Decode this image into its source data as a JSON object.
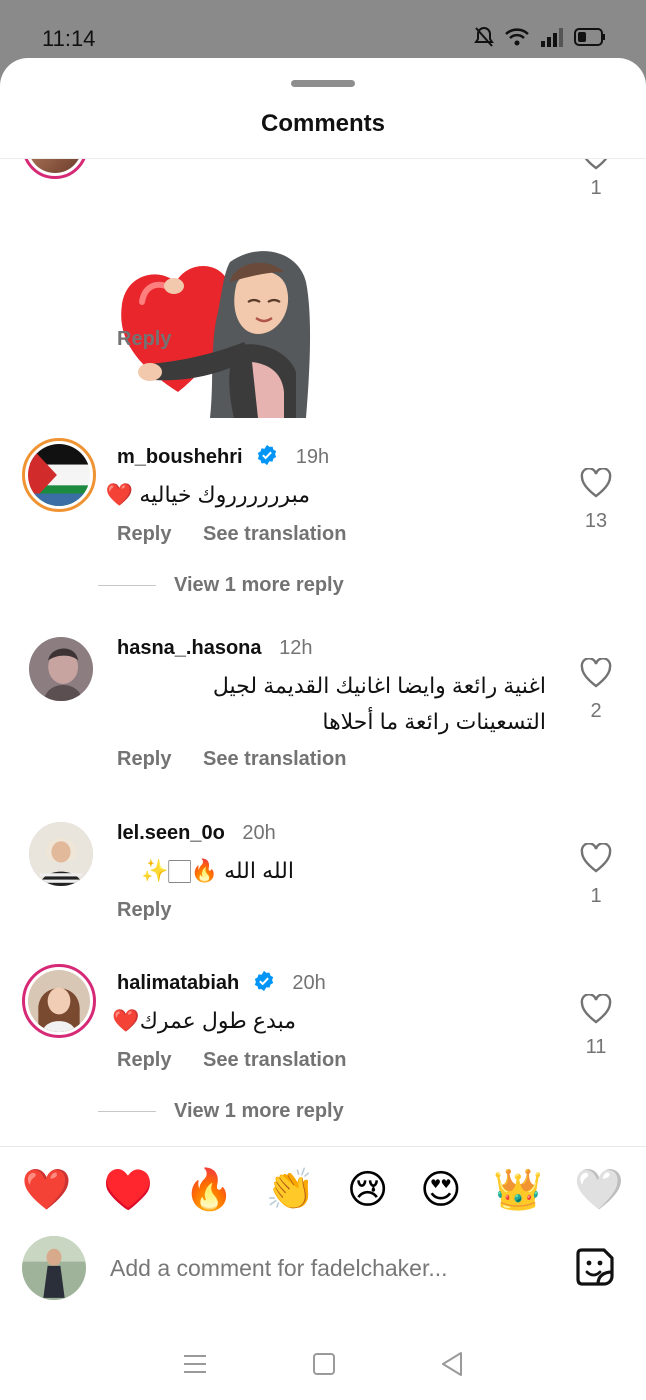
{
  "status": {
    "time": "11:14"
  },
  "sheet": {
    "title": "Comments"
  },
  "top_comment": {
    "likes": "1",
    "reply_label": "Reply"
  },
  "comments": [
    {
      "username": "m_boushehri",
      "verified": true,
      "time": "19h",
      "text": "مبرررررروك خياليه ❤️",
      "reply_label": "Reply",
      "translate_label": "See translation",
      "likes": "13",
      "more_replies": "View 1 more reply"
    },
    {
      "username": "hasna_.hasona",
      "verified": false,
      "time": "12h",
      "text_line1": "اغنية رائعة وايضا اغانيك القديمة لجيل",
      "text_line2": "التسعينات رائعة ما أحلاها",
      "reply_label": "Reply",
      "translate_label": "See translation",
      "likes": "2"
    },
    {
      "username": "lel.seen_0o",
      "verified": false,
      "time": "20h",
      "text": "الله الله 🔥🏻✨",
      "reply_label": "Reply",
      "likes": "1"
    },
    {
      "username": "halimatabiah",
      "verified": true,
      "time": "20h",
      "text": "مبدع طول عمرك❤️",
      "reply_label": "Reply",
      "translate_label": "See translation",
      "likes": "11",
      "more_replies": "View 1 more reply"
    }
  ],
  "emoji_bar": [
    "❤️",
    "♥️",
    "🔥",
    "👏",
    "😢",
    "😍",
    "👑",
    "🤍"
  ],
  "compose": {
    "placeholder": "Add a comment for fadelchaker..."
  },
  "colors": {
    "accent_ring": "#d62976",
    "verified_blue": "#0095f6",
    "muted_text": "#737373"
  }
}
